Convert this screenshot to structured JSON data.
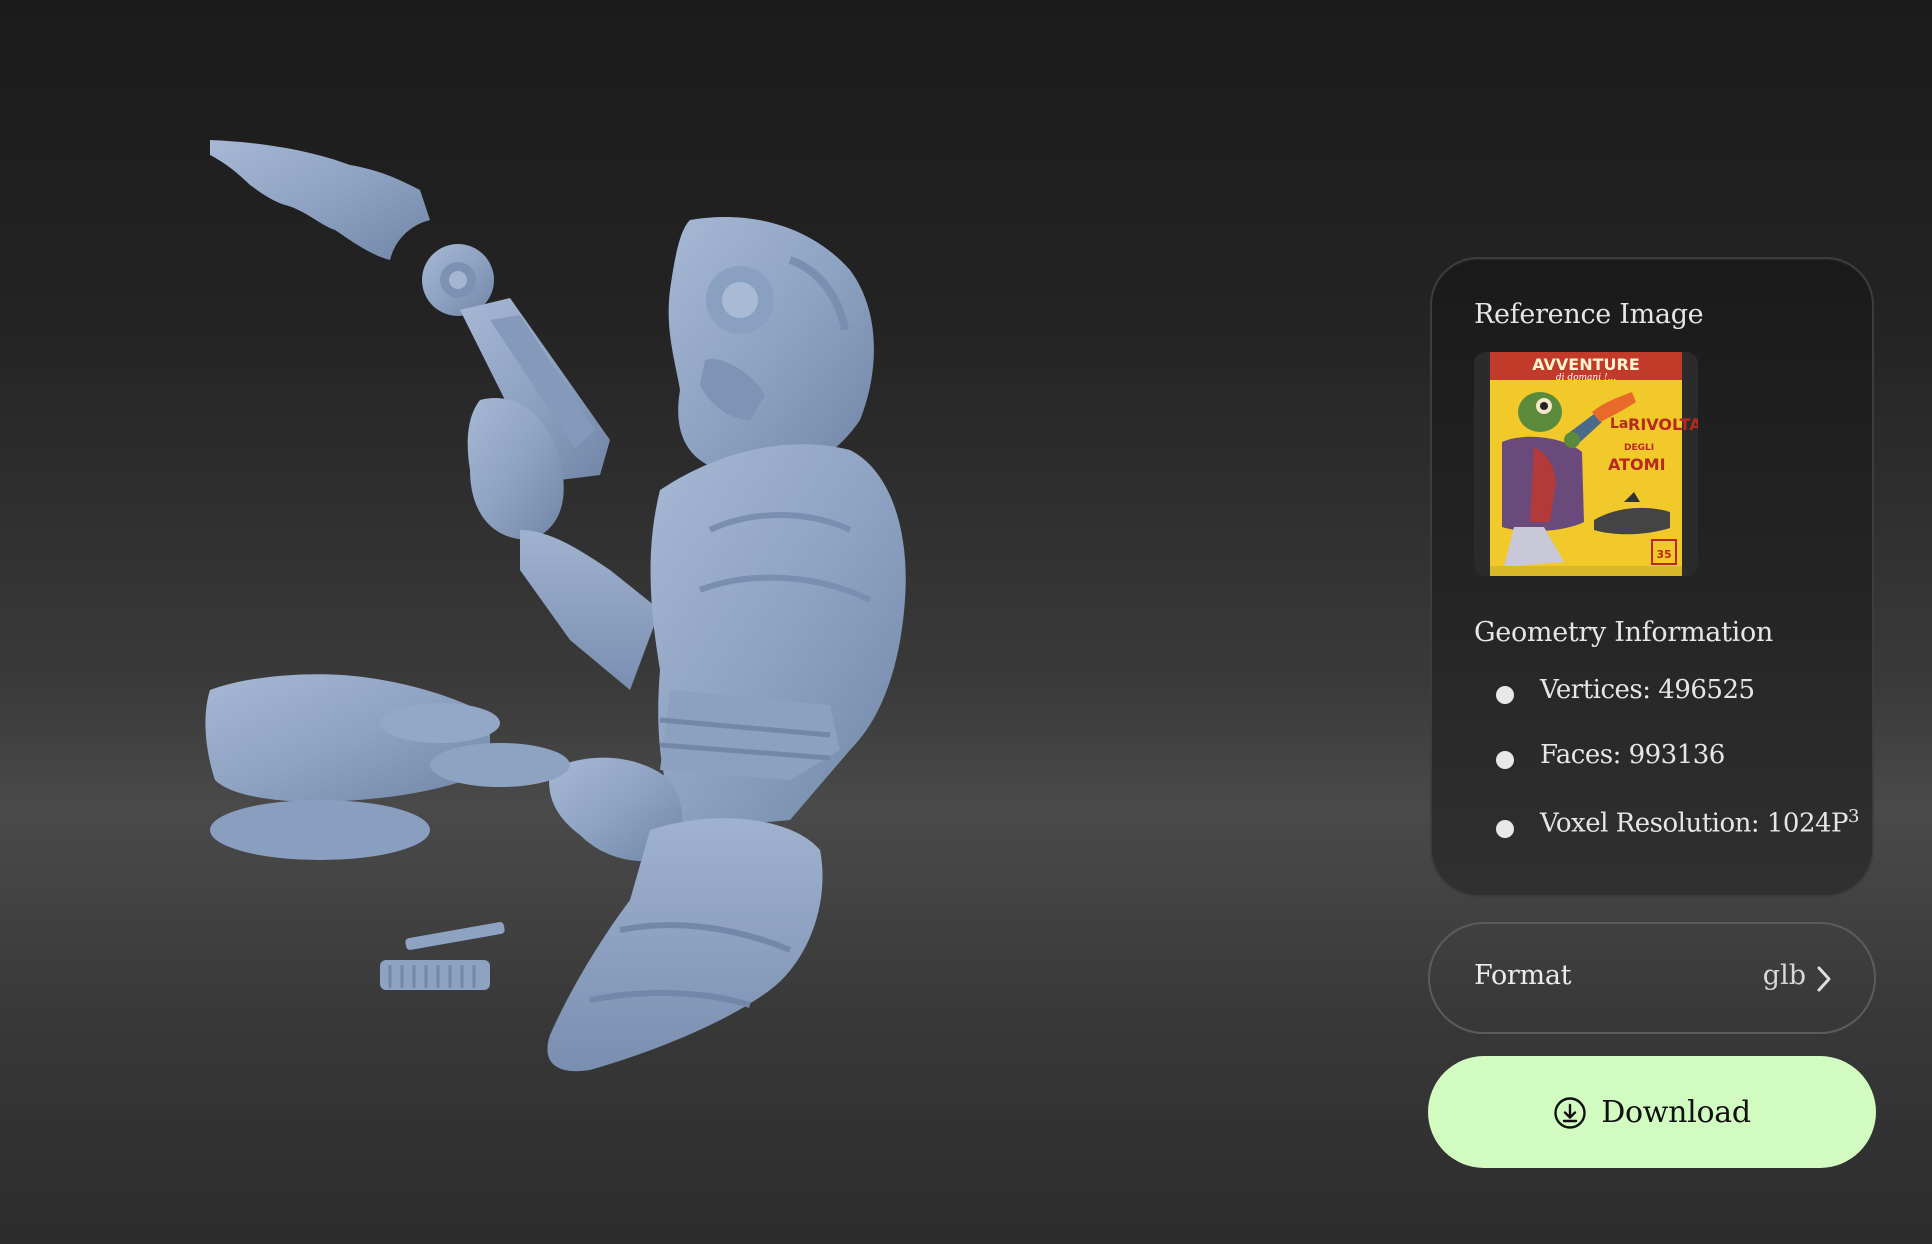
{
  "viewer": {
    "model_name": "3d-model-figure",
    "model_color": "#8fa3c2"
  },
  "panel": {
    "reference_heading": "Reference Image",
    "reference_image_text": {
      "title": "AVVENTURE",
      "subtitle": "di domani !...",
      "headline": [
        "La",
        "RIVOLTA",
        "DEGLI",
        "ATOMI"
      ],
      "price": "35"
    },
    "geometry_heading": "Geometry Information",
    "geometry": {
      "vertices_label": "Vertices: 496525",
      "faces_label": "Faces: 993136",
      "voxel_label": "Voxel Resolution: 1024P",
      "voxel_exponent": "3"
    }
  },
  "format": {
    "label": "Format",
    "value": "glb",
    "icon": "chevron-right-icon"
  },
  "download": {
    "label": "Download",
    "icon": "download-icon",
    "color": "#d2fbc1"
  }
}
